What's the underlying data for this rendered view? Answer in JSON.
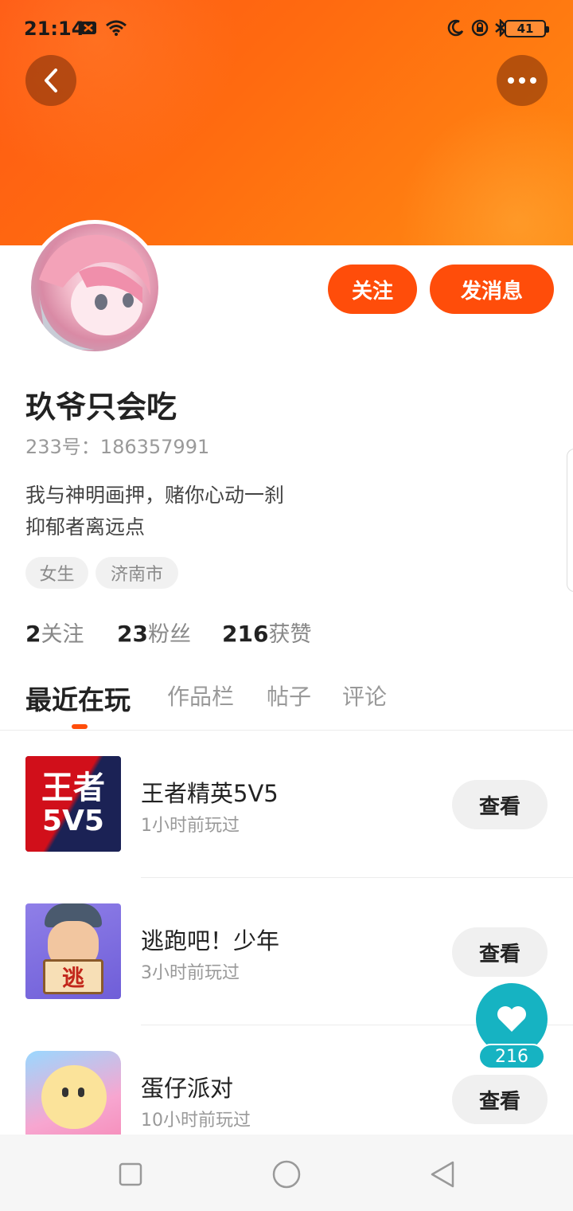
{
  "status_bar": {
    "time": "21:14",
    "battery": "41"
  },
  "profile": {
    "name": "玖爷只会吃",
    "id_text": "233号：186357991",
    "bio_line1": "我与神明画押，赌你心动一刹",
    "bio_line2": "抑郁者离远点",
    "tags": [
      "女生",
      "济南市"
    ],
    "follow_label": "关注",
    "message_label": "发消息"
  },
  "stats": {
    "following_count": "2",
    "following_label": "关注",
    "followers_count": "23",
    "followers_label": "粉丝",
    "likes_count": "216",
    "likes_label": "获赞"
  },
  "tabs": [
    "最近在玩",
    "作品栏",
    "帖子",
    "评论"
  ],
  "games": [
    {
      "name": "王者精英5V5",
      "time": "1小时前玩过",
      "button": "查看",
      "icon_text_1": "王者",
      "icon_text_2": "5V5"
    },
    {
      "name": "逃跑吧！少年",
      "time": "3小时前玩过",
      "button": "查看",
      "icon_text": "逃"
    },
    {
      "name": "蛋仔派对",
      "time": "10小时前玩过",
      "button": "查看"
    }
  ],
  "floating_like": {
    "count": "216"
  },
  "colors": {
    "accent": "#ff4d0a",
    "banner_start": "#ff5a14",
    "banner_end": "#ff8a12",
    "like_fab": "#16b3c2"
  },
  "icons": {
    "back": "chevron-left-icon",
    "more": "more-dots-icon",
    "like": "heart-icon"
  }
}
